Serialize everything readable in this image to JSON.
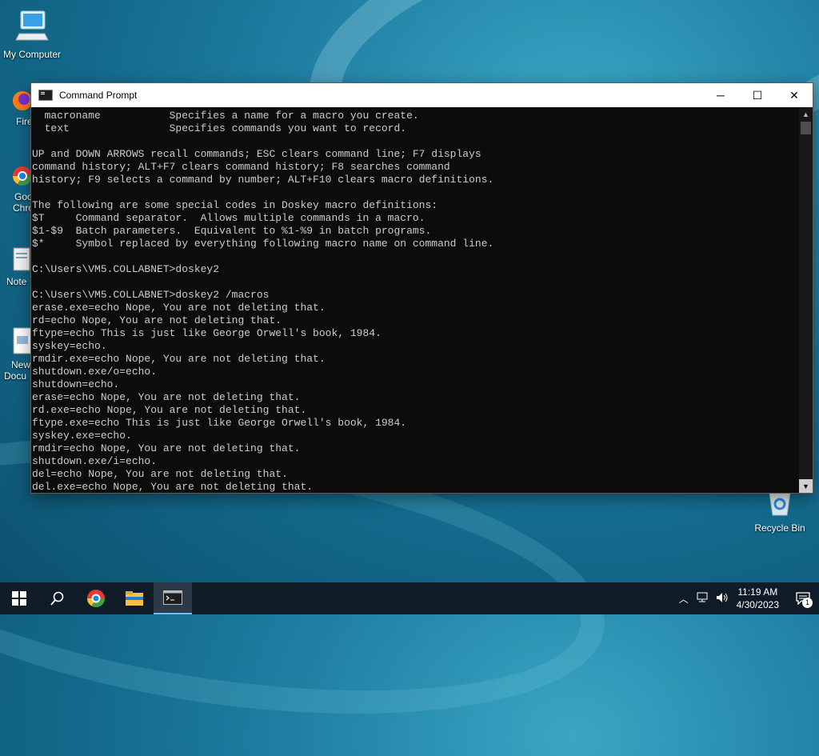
{
  "desktop": {
    "icons": [
      {
        "label": "My Computer"
      },
      {
        "label": "Recycle Bin"
      }
    ],
    "partial_labels": {
      "firefox": "Fire",
      "chrome_line1": "Goo",
      "chrome_line2": "Chro",
      "notepad": "Note",
      "new_doc_line1": "New",
      "new_doc_line2": "Docu"
    }
  },
  "window": {
    "title": "Command Prompt",
    "controls": {
      "minimize": "─",
      "maximize": "☐",
      "close": "✕"
    },
    "console_text": "  macroname           Specifies a name for a macro you create.\n  text                Specifies commands you want to record.\n\nUP and DOWN ARROWS recall commands; ESC clears command line; F7 displays\ncommand history; ALT+F7 clears command history; F8 searches command\nhistory; F9 selects a command by number; ALT+F10 clears macro definitions.\n\nThe following are some special codes in Doskey macro definitions:\n$T     Command separator.  Allows multiple commands in a macro.\n$1-$9  Batch parameters.  Equivalent to %1-%9 in batch programs.\n$*     Symbol replaced by everything following macro name on command line.\n\nC:\\Users\\VM5.COLLABNET>doskey2\n\nC:\\Users\\VM5.COLLABNET>doskey2 /macros\nerase.exe=echo Nope, You are not deleting that.\nrd=echo Nope, You are not deleting that.\nftype=echo This is just like George Orwell's book, 1984.\nsyskey=echo.\nrmdir.exe=echo Nope, You are not deleting that.\nshutdown.exe/o=echo.\nshutdown=echo.\nerase=echo Nope, You are not deleting that.\nrd.exe=echo Nope, You are not deleting that.\nftype.exe=echo This is just like George Orwell's book, 1984.\nsyskey.exe=echo.\nrmdir=echo Nope, You are not deleting that.\nshutdown.exe/i=echo.\ndel=echo Nope, You are not deleting that.\ndel.exe=echo Nope, You are not deleting that."
  },
  "taskbar": {
    "clock_time": "11:19 AM",
    "clock_date": "4/30/2023",
    "notification_count": "1"
  }
}
